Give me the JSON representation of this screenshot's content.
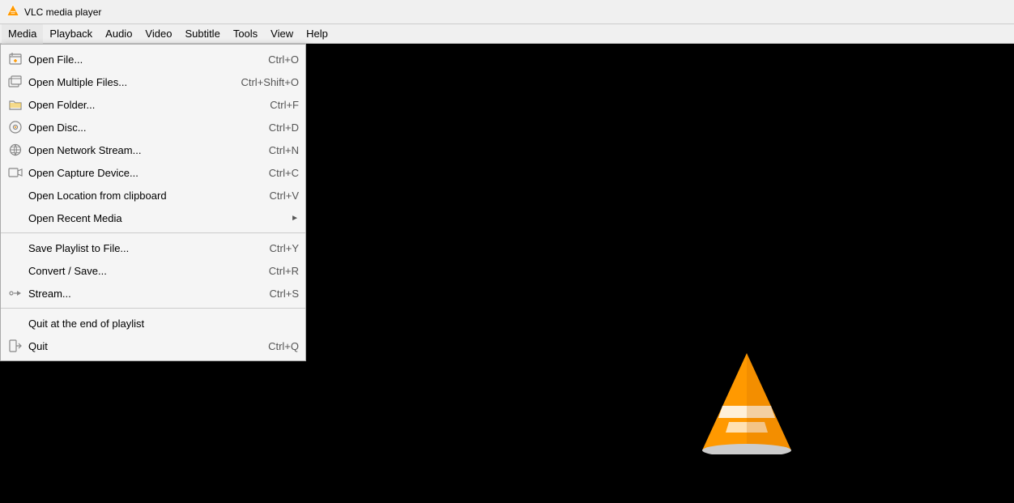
{
  "app": {
    "title": "VLC media player"
  },
  "titlebar": {
    "icon": "vlc-icon",
    "title": "VLC media player"
  },
  "menubar": {
    "items": [
      {
        "label": "Media",
        "active": true
      },
      {
        "label": "Playback",
        "active": false
      },
      {
        "label": "Audio",
        "active": false
      },
      {
        "label": "Video",
        "active": false
      },
      {
        "label": "Subtitle",
        "active": false
      },
      {
        "label": "Tools",
        "active": false
      },
      {
        "label": "View",
        "active": false
      },
      {
        "label": "Help",
        "active": false
      }
    ]
  },
  "media_menu": {
    "items": [
      {
        "id": "open-file",
        "label": "Open File...",
        "shortcut": "Ctrl+O",
        "has_icon": true,
        "has_arrow": false
      },
      {
        "id": "open-multiple",
        "label": "Open Multiple Files...",
        "shortcut": "Ctrl+Shift+O",
        "has_icon": true,
        "has_arrow": false
      },
      {
        "id": "open-folder",
        "label": "Open Folder...",
        "shortcut": "Ctrl+F",
        "has_icon": true,
        "has_arrow": false
      },
      {
        "id": "open-disc",
        "label": "Open Disc...",
        "shortcut": "Ctrl+D",
        "has_icon": true,
        "has_arrow": false
      },
      {
        "id": "open-network",
        "label": "Open Network Stream...",
        "shortcut": "Ctrl+N",
        "has_icon": true,
        "has_arrow": false
      },
      {
        "id": "open-capture",
        "label": "Open Capture Device...",
        "shortcut": "Ctrl+C",
        "has_icon": true,
        "has_arrow": false
      },
      {
        "id": "open-location",
        "label": "Open Location from clipboard",
        "shortcut": "Ctrl+V",
        "has_icon": false,
        "has_arrow": false
      },
      {
        "id": "open-recent",
        "label": "Open Recent Media",
        "shortcut": "",
        "has_icon": false,
        "has_arrow": true
      },
      {
        "id": "sep1",
        "type": "separator"
      },
      {
        "id": "save-playlist",
        "label": "Save Playlist to File...",
        "shortcut": "Ctrl+Y",
        "has_icon": false,
        "has_arrow": false
      },
      {
        "id": "convert-save",
        "label": "Convert / Save...",
        "shortcut": "Ctrl+R",
        "has_icon": false,
        "has_arrow": false
      },
      {
        "id": "stream",
        "label": "Stream...",
        "shortcut": "Ctrl+S",
        "has_icon": true,
        "has_arrow": false
      },
      {
        "id": "sep2",
        "type": "separator"
      },
      {
        "id": "quit-end",
        "label": "Quit at the end of playlist",
        "shortcut": "",
        "has_icon": false,
        "has_arrow": false
      },
      {
        "id": "quit",
        "label": "Quit",
        "shortcut": "Ctrl+Q",
        "has_icon": true,
        "has_arrow": false
      }
    ]
  }
}
